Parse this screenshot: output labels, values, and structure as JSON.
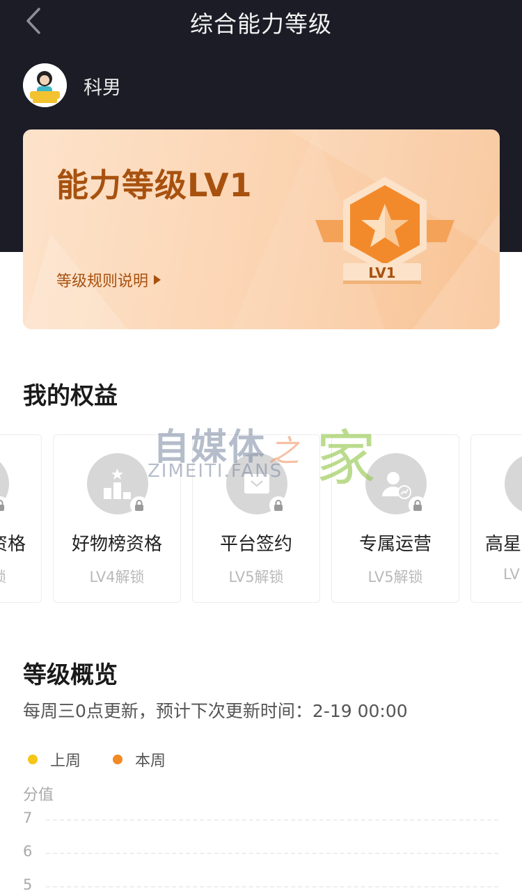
{
  "header": {
    "title": "综合能力等级",
    "back_icon": "chevron-left-icon"
  },
  "user": {
    "name": "科男",
    "avatar_icon": "avatar-icon"
  },
  "level_card": {
    "title": "能力等级LV1",
    "rules_link": "等级规则说明",
    "badge_label": "LV1",
    "badge_icon": "star-badge-icon"
  },
  "benefits": {
    "title": "我的权益",
    "items": [
      {
        "name": "资格",
        "unlock": "锁",
        "icon": "partial-icon"
      },
      {
        "name": "好物榜资格",
        "unlock": "LV4解锁",
        "icon": "podium-icon"
      },
      {
        "name": "平台签约",
        "unlock": "LV5解锁",
        "icon": "envelope-icon"
      },
      {
        "name": "专属运营",
        "unlock": "LV5解锁",
        "icon": "user-chart-icon"
      },
      {
        "name": "高星",
        "unlock": "LV",
        "icon": "partial-icon"
      }
    ]
  },
  "watermark": {
    "cn_1": "自媒体",
    "cn_2": "之",
    "cn_3": "家",
    "en": "ZIMEITI.FANS"
  },
  "overview": {
    "title": "等级概览",
    "description": "每周三0点更新，预计下次更新时间：2-19 00:00",
    "legend": [
      {
        "label": "上周",
        "color": "#f5c518"
      },
      {
        "label": "本周",
        "color": "#f08a24"
      }
    ],
    "y_axis_label": "分值",
    "y_ticks": [
      "7",
      "6",
      "5"
    ]
  }
}
